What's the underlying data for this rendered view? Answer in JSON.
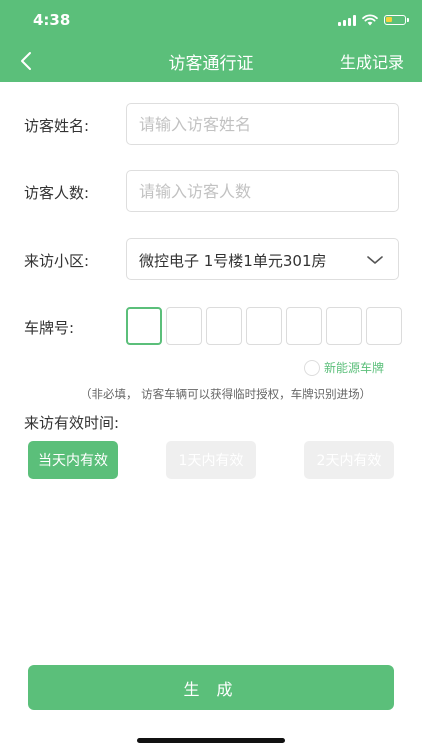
{
  "status_bar": {
    "time": "4:38"
  },
  "nav": {
    "title": "访客通行证",
    "records_label": "生成记录"
  },
  "form": {
    "name": {
      "label": "访客姓名:",
      "placeholder": "请输入访客姓名",
      "value": ""
    },
    "count": {
      "label": "访客人数:",
      "placeholder": "请输入访客人数",
      "value": ""
    },
    "community": {
      "label": "来访小区:",
      "value": "微控电子 1号楼1单元301房"
    },
    "plate": {
      "label": "车牌号:",
      "boxes": 7,
      "active_index": 0
    },
    "ev_plate_label": "新能源车牌",
    "hint": "（非必填， 访客车辆可以获得临时授权，车牌识别进场）",
    "validity": {
      "label": "来访有效时间:",
      "options": [
        "当天内有效",
        "1天内有效",
        "2天内有效"
      ],
      "selected_index": 0
    }
  },
  "generate_label": "生 成",
  "colors": {
    "accent": "#5BBF7A",
    "disabled": "#EFEFEF"
  }
}
